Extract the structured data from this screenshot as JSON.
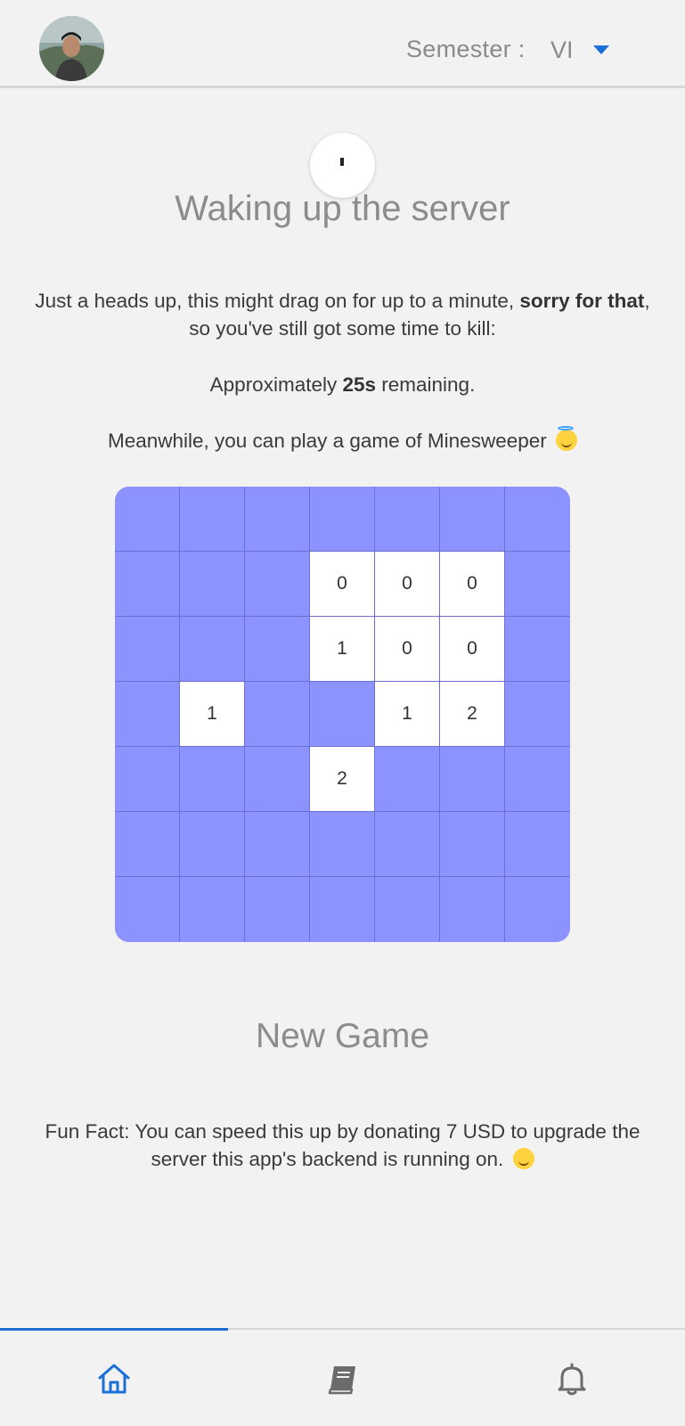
{
  "header": {
    "semester_label": "Semester :",
    "semester_value": "VI"
  },
  "loading": {
    "title": "Waking up the server",
    "notice_part1": "Just a heads up, this might drag on for up to a minute, ",
    "notice_bold": "sorry for that",
    "notice_part2": ", so you've still got some time to kill:",
    "remaining_prefix": "Approximately ",
    "remaining_value": "25s",
    "remaining_suffix": " remaining.",
    "meanwhile": "Meanwhile, you can play a game of Minesweeper",
    "meanwhile_emoji": "smiling-face-with-halo-icon"
  },
  "minesweeper": {
    "rows": 7,
    "cols": 7,
    "board": [
      [
        null,
        null,
        null,
        null,
        null,
        null,
        null
      ],
      [
        null,
        null,
        null,
        "0",
        "0",
        "0",
        null
      ],
      [
        null,
        null,
        null,
        "1",
        "0",
        "0",
        null
      ],
      [
        null,
        "1",
        null,
        null,
        "1",
        "2",
        null
      ],
      [
        null,
        null,
        null,
        "2",
        null,
        null,
        null
      ],
      [
        null,
        null,
        null,
        null,
        null,
        null,
        null
      ],
      [
        null,
        null,
        null,
        null,
        null,
        null,
        null
      ]
    ],
    "new_game_label": "New Game"
  },
  "fun_fact": {
    "text": "Fun Fact: You can speed this up by donating 7 USD to upgrade the server this app's backend is running on.",
    "emoji": "slightly-smiling-face-icon"
  },
  "bottom_nav": {
    "items": [
      "home-icon",
      "book-icon",
      "bell-icon"
    ],
    "active_index": 0
  },
  "colors": {
    "accent": "#1d6fd8",
    "board_cell": "#8c93ff",
    "board_grid": "#6a70d6",
    "open_cell": "#ffffff",
    "background": "#f2f2f2"
  }
}
